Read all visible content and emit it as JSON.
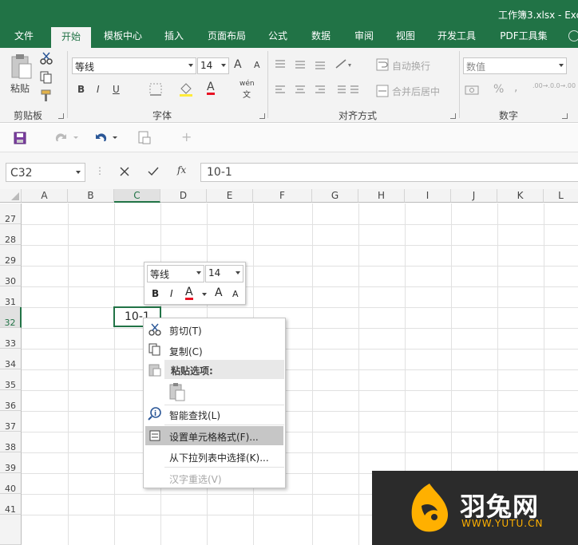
{
  "window": {
    "title": "工作簿3.xlsx - Exc"
  },
  "tabs": [
    {
      "label": "文件"
    },
    {
      "label": "开始",
      "active": true
    },
    {
      "label": "模板中心"
    },
    {
      "label": "插入"
    },
    {
      "label": "页面布局"
    },
    {
      "label": "公式"
    },
    {
      "label": "数据"
    },
    {
      "label": "审阅"
    },
    {
      "label": "视图"
    },
    {
      "label": "开发工具"
    },
    {
      "label": "PDF工具集"
    }
  ],
  "ribbon": {
    "clipboard": {
      "paste_label": "粘贴",
      "group_label": "剪贴板"
    },
    "font": {
      "font_name": "等线",
      "font_size": "14",
      "grow": "A",
      "shrink": "A",
      "bold": "B",
      "italic": "I",
      "underline": "U",
      "font_color_glyph": "A",
      "wen": "wén",
      "wen_sub": "文",
      "group_label": "字体"
    },
    "alignment": {
      "wrap_text": "自动换行",
      "merge_center": "合并后居中",
      "group_label": "对齐方式"
    },
    "number": {
      "format": "数值",
      "group_label": "数字",
      "percent": "%",
      "comma": ",",
      "inc": ".00→.0",
      "dec": ".0→.00"
    }
  },
  "namebox": "C32",
  "formula": {
    "fx": "fx",
    "value": "10-1"
  },
  "columns": [
    "A",
    "B",
    "C",
    "D",
    "E",
    "F",
    "G",
    "H",
    "I",
    "J",
    "K",
    "L"
  ],
  "rows": [
    "27",
    "28",
    "29",
    "30",
    "31",
    "32",
    "33",
    "34",
    "35",
    "36",
    "37",
    "38",
    "39",
    "40",
    "41"
  ],
  "cell": {
    "ref": "C32",
    "value": "10-1"
  },
  "mini_toolbar": {
    "font": "等线",
    "size": "14",
    "bold": "B",
    "italic": "I",
    "color": "A",
    "grow": "A",
    "shrink": "A"
  },
  "context_menu": {
    "cut": "剪切(T)",
    "copy": "复制(C)",
    "paste_header": "粘贴选项:",
    "smart_lookup": "智能查找(L)",
    "format_cells": "设置单元格格式(F)...",
    "pick_list": "从下拉列表中选择(K)...",
    "hanzi": "汉字重选(V)"
  },
  "watermark": {
    "brand": "羽兔网",
    "url": "WWW.YUTU.CN"
  },
  "colors": {
    "accent": "#217346",
    "font_red": "#e81123",
    "logo_orange": "#ffb000"
  }
}
